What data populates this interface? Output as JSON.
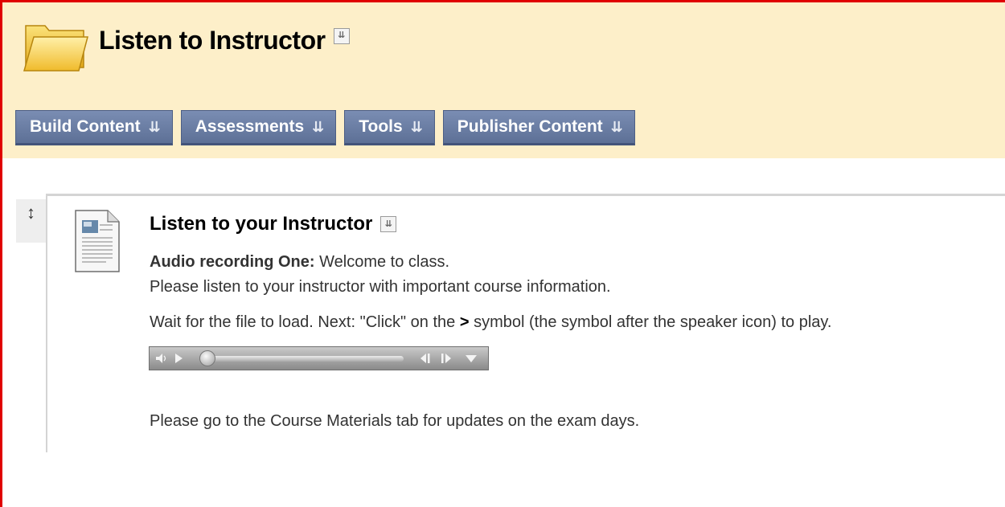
{
  "page": {
    "title": "Listen to Instructor",
    "title_menu_icon": "double-chevron-down-icon",
    "folder_icon": "folder-icon"
  },
  "toolbar": {
    "items": [
      {
        "label": "Build Content",
        "icon": "double-chevron-down-icon"
      },
      {
        "label": "Assessments",
        "icon": "double-chevron-down-icon"
      },
      {
        "label": "Tools",
        "icon": "double-chevron-down-icon"
      },
      {
        "label": "Publisher Content",
        "icon": "double-chevron-down-icon"
      }
    ]
  },
  "content_item": {
    "title": "Listen to your Instructor",
    "line1_bold": "Audio recording One:",
    "line1_rest": " Welcome to class.",
    "line2": "Please listen to your instructor with important course information.",
    "line3_before": "Wait for the file to load.  Next: \"Click\" on the ",
    "line3_symbol": ">",
    "line3_after": " symbol (the symbol after the speaker icon) to play.",
    "line4": "Please go to the Course Materials tab for updates on the exam days."
  },
  "audio_player": {
    "progress": 0,
    "controls": [
      "speaker-icon",
      "play-icon",
      "seek-track",
      "rewind-icon",
      "fast-forward-icon",
      "menu-arrow-icon"
    ]
  },
  "colors": {
    "frame_border": "#e00000",
    "header_bg": "#fdefc9",
    "toolbar_button_bg": "#6a7da3",
    "toolbar_button_text": "#ffffff"
  }
}
